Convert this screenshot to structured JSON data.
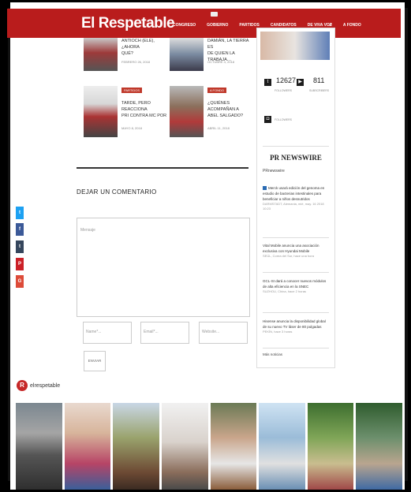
{
  "site": {
    "logo": "El Respetable"
  },
  "nav": {
    "items": [
      "CONGRESO",
      "GOBIERNO",
      "PARTIDOS",
      "CANDIDATOS",
      "DE VIVA VOZ",
      "A FONDO"
    ]
  },
  "cards": [
    {
      "title_1": "ANTIOCH (ELE), ¿AHORA",
      "title_2": "QUÉ?",
      "meta": "FEBRERO 26, 2018"
    },
    {
      "title_1": "DAMIÁN, LA TIERRA ES",
      "title_2": "DE QUIEN LA TRABAJA…",
      "meta": "OCTUBRE 4, 2018"
    },
    {
      "tag": "PARTIDOS",
      "title_1": "TARDE, PERO REACCIONA",
      "title_2": "PRI CONTRA MC POR",
      "meta": "MAYO 8, 2018"
    },
    {
      "tag": "A FONDO",
      "title_1": "¿QUIÉNES ACOMPAÑAN A",
      "title_2": "ABEL SALGADO?",
      "meta": "ABRIL 11, 2018"
    }
  ],
  "comment": {
    "heading": "DEJAR UN COMENTARIO",
    "message_placeholder": "Mensaje",
    "name_placeholder": "Name*...",
    "email_placeholder": "Email*...",
    "website_placeholder": "Website...",
    "submit_label": "ENVIAR"
  },
  "social": {
    "twitter_count": "12627",
    "twitter_label": "FOLLOWERS",
    "youtube_count": "811",
    "youtube_label": "SUBSCRIBERS",
    "instagram_label": "FOLLOWERS"
  },
  "pr": {
    "title": "PR NEWSWIRE",
    "sub": "PRnewswire",
    "items": [
      {
        "text": "Merck usará edición del genoma en estudio de bacterias intestinales para beneficiar a niños desnutridos",
        "meta": "DARMSTADT, Alemania, mié, may. 16 2018 10:23"
      },
      {
        "text": "Vital Mobile anuncia una asociación exclusiva con Hyundai Mobile",
        "meta": "SEÚL, Corea del Sur, hace una hora"
      },
      {
        "text": "GCL-SI dará a conocer nuevos módulos de alta eficiencia en la SNEC",
        "meta": "SUZHOU, China, hace 2 horas"
      },
      {
        "text": "Hisense anuncia la disponibilidad global de su nuevo TV láser de 80 pulgadas",
        "meta": "PEKÍN, hace 3 horas"
      }
    ],
    "more": "Más noticias"
  },
  "share": {
    "items": [
      {
        "glyph": "t",
        "color": "#1da1f2"
      },
      {
        "glyph": "f",
        "color": "#3b5998"
      },
      {
        "glyph": "t",
        "color": "#35465c"
      },
      {
        "glyph": "P",
        "color": "#cb2027"
      },
      {
        "glyph": "G",
        "color": "#dd4b39"
      }
    ]
  },
  "instagram": {
    "logo_letter": "R",
    "handle": "elrespetable"
  },
  "colors": {
    "brand": "#b91c1c",
    "accent": "#c0392b"
  }
}
